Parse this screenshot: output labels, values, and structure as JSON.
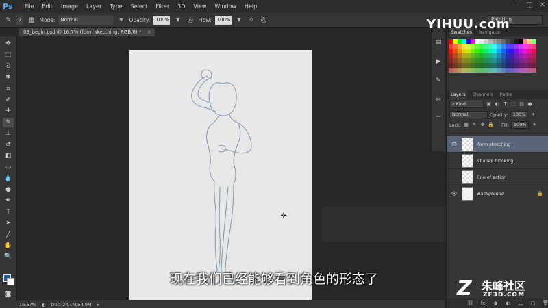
{
  "app": {
    "logo": "Ps",
    "menu": [
      "File",
      "Edit",
      "Image",
      "Layer",
      "Type",
      "Select",
      "Filter",
      "3D",
      "View",
      "Window",
      "Help"
    ]
  },
  "options_bar": {
    "brush_size": "7",
    "mode_label": "Mode:",
    "mode_value": "Normal",
    "opacity_label": "Opacity:",
    "opacity_value": "100%",
    "flow_label": "Flow:",
    "flow_value": "100%",
    "workspace": "Painting"
  },
  "document_tab": {
    "title": "03_begin.psd @ 16.7% (form sketching, RGB/8) *"
  },
  "status_bar": {
    "zoom": "16.67%",
    "doc_size": "Doc: 24.1M/54.9M"
  },
  "colors": {
    "foreground": "#1c5fa0",
    "background": "#ffffff"
  },
  "swatches_panel": {
    "tabs": [
      "Swatches",
      "Navigator"
    ]
  },
  "layers_panel": {
    "tabs": [
      "Layers",
      "Channels",
      "Paths"
    ],
    "filter_kind": "Kind",
    "blend_mode": "Normal",
    "opacity_label": "Opacity:",
    "opacity_value": "100%",
    "lock_label": "Lock:",
    "fill_label": "Fill:",
    "fill_value": "100%",
    "layers": [
      {
        "name": "form sketching",
        "selected": true,
        "visible": true,
        "type": "transparent"
      },
      {
        "name": "shapes blocking",
        "selected": false,
        "visible": false,
        "type": "transparent"
      },
      {
        "name": "line of action",
        "selected": false,
        "visible": false,
        "type": "transparent"
      },
      {
        "name": "Background",
        "selected": false,
        "visible": true,
        "type": "background",
        "locked": true
      }
    ]
  },
  "watermarks": {
    "top": "YIHUU.com",
    "brand": "朱峰社区",
    "domain": "ZF3D.COM"
  },
  "subtitle": "现在我们已经能够看到角色的形态了"
}
